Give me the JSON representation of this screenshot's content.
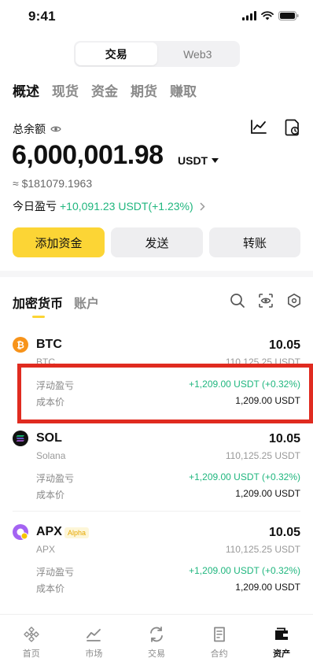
{
  "status": {
    "time": "9:41"
  },
  "segment": {
    "items": [
      "交易",
      "Web3"
    ]
  },
  "tabs": [
    "概述",
    "现货",
    "资金",
    "期货",
    "赚取"
  ],
  "balance": {
    "label": "总余额",
    "amount": "6,000,001.98",
    "unit": "USDT",
    "usd": "≈ $181079.1963",
    "pnl_label": "今日盈亏",
    "pnl_value": "+10,091.23 USDT(+1.23%)"
  },
  "actions": {
    "deposit": "添加资金",
    "send": "发送",
    "transfer": "转账"
  },
  "asset_tabs": [
    "加密货币",
    "账户"
  ],
  "coins": [
    {
      "symbol": "BTC",
      "qty": "10.05",
      "name": "BTC",
      "value": "110,125.25 USDT",
      "float_label": "浮动盈亏",
      "float_value": "+1,209.00 USDT (+0.32%)",
      "cost_label": "成本价",
      "cost_value": "1,209.00 USDT"
    },
    {
      "symbol": "SOL",
      "qty": "10.05",
      "name": "Solana",
      "value": "110,125.25 USDT",
      "float_label": "浮动盈亏",
      "float_value": "+1,209.00 USDT (+0.32%)",
      "cost_label": "成本价",
      "cost_value": "1,209.00 USDT"
    },
    {
      "symbol": "APX",
      "badge": "Alpha",
      "qty": "10.05",
      "name": "APX",
      "value": "110,125.25 USDT",
      "float_label": "浮动盈亏",
      "float_value": "+1,209.00 USDT (+0.32%)",
      "cost_label": "成本价",
      "cost_value": "1,209.00 USDT"
    }
  ],
  "nav": [
    "首页",
    "市场",
    "交易",
    "合约",
    "资产"
  ],
  "colors": {
    "accent": "#fcd535",
    "positive": "#1fb67e",
    "highlight": "#e02b20"
  }
}
